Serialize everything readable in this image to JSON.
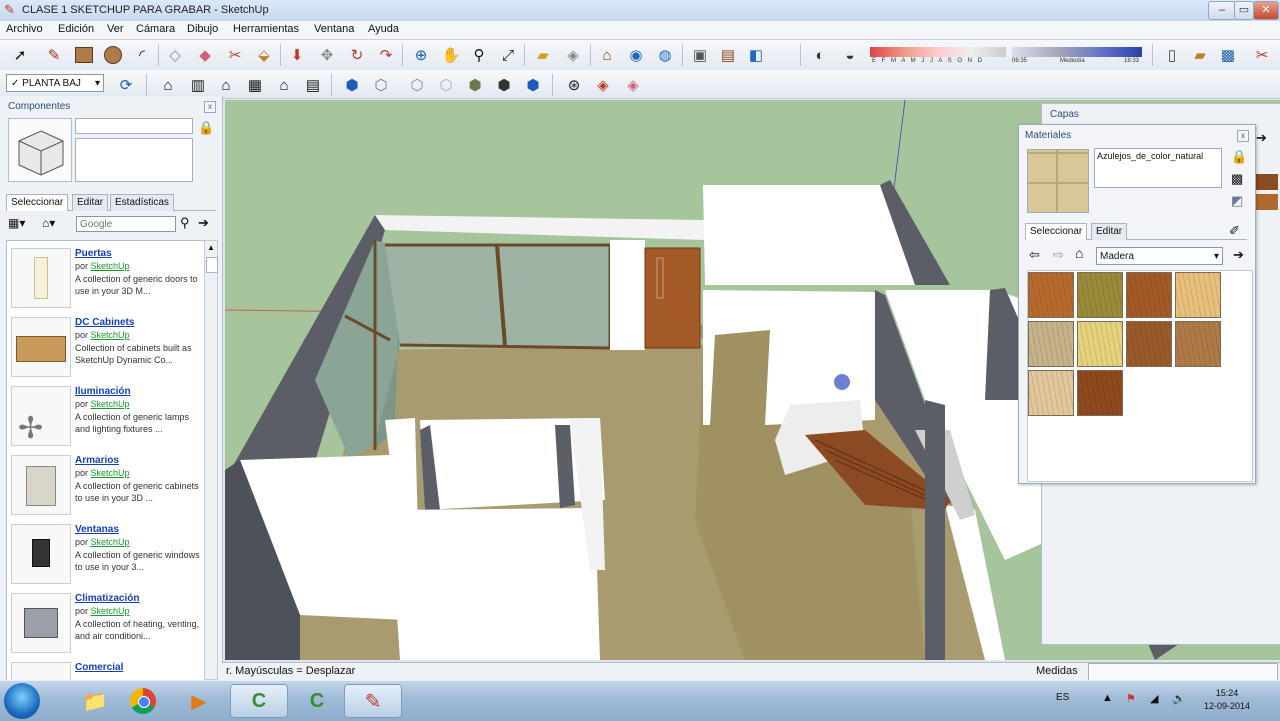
{
  "window": {
    "title": "CLASE 1 SKETCHUP PARA GRABAR - SketchUp",
    "min_label": "‒",
    "max_label": "▭",
    "close_label": "✕"
  },
  "menu": [
    "Archivo",
    "Edición",
    "Ver",
    "Cámara",
    "Dibujo",
    "Herramientas",
    "Ventana",
    "Ayuda"
  ],
  "toolbar": {
    "scene_select": "PLANTA BAJ",
    "shadow_months": "E F M A M J J A S O N D",
    "time_start": "06:35",
    "time_mid": "Mediodía",
    "time_end": "18:33"
  },
  "components_panel": {
    "title": "Componentes",
    "close_label": "x",
    "tabs": [
      "Seleccionar",
      "Editar",
      "Estadísticas"
    ],
    "search_placeholder": "Google",
    "items": [
      {
        "name": "Puertas",
        "by": "por",
        "author": "SketchUp",
        "desc": "A collection of generic doors to use in your 3D M..."
      },
      {
        "name": "DC Cabinets",
        "by": "por",
        "author": "SketchUp",
        "desc": "Collection of cabinets built as SketchUp Dynamic Co..."
      },
      {
        "name": "Iluminación",
        "by": "por",
        "author": "SketchUp",
        "desc": "A collection of generic lamps and lighting fixtures ..."
      },
      {
        "name": "Armarios",
        "by": "por",
        "author": "SketchUp",
        "desc": "A collection of generic cabinets to use in your 3D ..."
      },
      {
        "name": "Ventanas",
        "by": "por",
        "author": "SketchUp",
        "desc": "A collection of generic windows to use in your 3..."
      },
      {
        "name": "Climatización",
        "by": "por",
        "author": "SketchUp",
        "desc": "A collection of heating, venting, and air conditioni..."
      },
      {
        "name": "Comercial",
        "by": "",
        "author": "",
        "desc": ""
      }
    ]
  },
  "capas_panel": {
    "title": "Capas"
  },
  "materials_panel": {
    "title": "Materiales",
    "close_label": "x",
    "material_name": "Azulejos_de_color_natural",
    "tabs": [
      "Seleccionar",
      "Editar"
    ],
    "library": "Madera",
    "swatches": [
      "#b86a2e",
      "#9a8a3a",
      "#a35a26",
      "#e8c07a",
      "#c7b28a",
      "#e6d27c",
      "#9b5a2a",
      "#b07a48",
      "#e2c79a",
      "#8e4a1e"
    ]
  },
  "status": {
    "hint": "r. Mayúsculas = Desplazar",
    "measures_label": "Medidas",
    "measures_value": ""
  },
  "taskbar": {
    "lang": "ES",
    "time": "15:24",
    "date": "12-09-2014"
  },
  "colors": {
    "sky": "#a6c59b",
    "floor": "#a89b6f",
    "wall": "#ffffff",
    "wall_shadow": "#5c5f67",
    "accent": "#1c6bbf"
  }
}
